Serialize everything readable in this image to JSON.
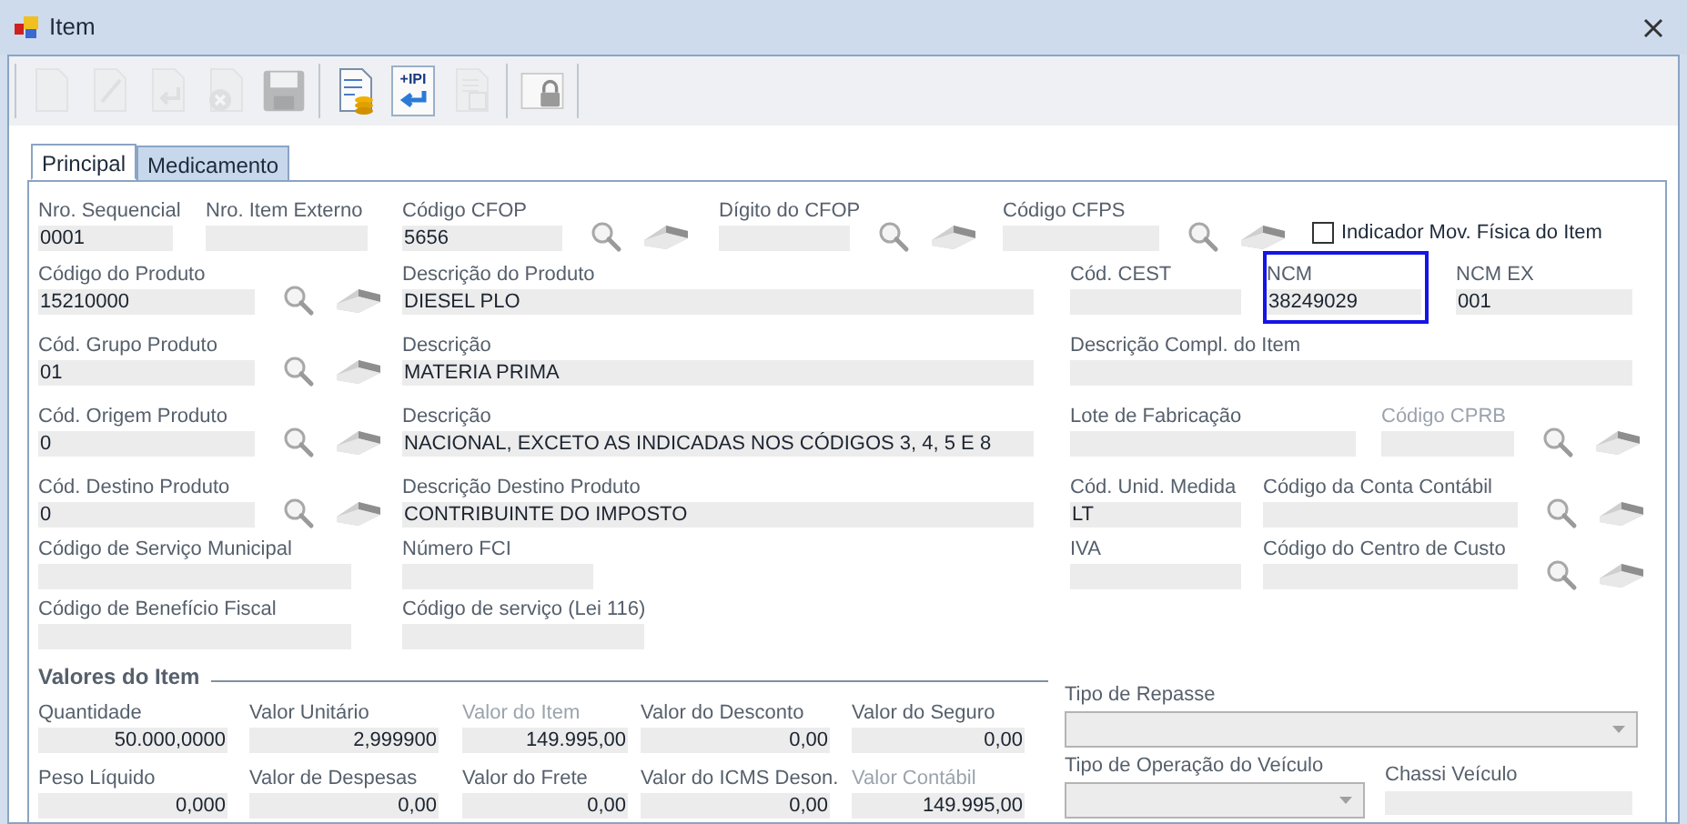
{
  "window": {
    "title": "Item"
  },
  "toolbar_groups": [
    [
      {
        "kind": "new",
        "disabled": true
      },
      {
        "kind": "edit",
        "disabled": true
      },
      {
        "kind": "undo",
        "disabled": true
      },
      {
        "kind": "delete",
        "disabled": true
      },
      {
        "kind": "save",
        "disabled": true
      }
    ],
    [
      {
        "kind": "coins",
        "disabled": false
      },
      {
        "kind": "ipi",
        "label": "+IPI",
        "disabled": false
      },
      {
        "kind": "copy",
        "disabled": true
      }
    ],
    [
      {
        "kind": "lock",
        "disabled": false
      }
    ]
  ],
  "tabs": [
    {
      "label": "Principal",
      "selected": true
    },
    {
      "label": "Medicamento",
      "selected": false
    }
  ],
  "fields": [
    {
      "label": "Nro. Sequencial",
      "value": "0001",
      "kind": "text",
      "disabled": false,
      "highlighted": false
    },
    {
      "label": "Nro. Item Externo",
      "kind": "text",
      "disabled": false,
      "highlighted": false
    },
    {
      "label": "Código CFOP",
      "value": "5656",
      "kind": "lookup",
      "disabled": false,
      "highlighted": false
    },
    {
      "label": "Dígito do CFOP",
      "kind": "lookup",
      "disabled": false,
      "highlighted": false
    },
    {
      "label": "Código CFPS",
      "kind": "lookup",
      "disabled": false,
      "highlighted": false
    },
    {
      "label": "Código do Produto",
      "value": "15210000",
      "kind": "lookup",
      "disabled": false,
      "highlighted": false
    },
    {
      "label": "Descrição do Produto",
      "value": "DIESEL PLO",
      "kind": "text",
      "disabled": false,
      "highlighted": false
    },
    {
      "label": "Cód. CEST",
      "kind": "text",
      "disabled": false,
      "highlighted": false
    },
    {
      "label": "NCM",
      "value": "38249029",
      "kind": "text",
      "disabled": false,
      "highlighted": true
    },
    {
      "label": "NCM EX",
      "value": "001",
      "kind": "text",
      "disabled": false,
      "highlighted": false
    },
    {
      "label": "Cód. Grupo Produto",
      "value": "01",
      "kind": "lookup",
      "disabled": false,
      "highlighted": false
    },
    {
      "label": "Descrição",
      "value": "MATERIA PRIMA",
      "kind": "text",
      "disabled": false,
      "highlighted": false
    },
    {
      "label": "Descrição Compl. do Item",
      "kind": "text",
      "disabled": false,
      "highlighted": false
    },
    {
      "label": "Cód. Origem Produto",
      "value": "0",
      "kind": "lookup",
      "disabled": false,
      "highlighted": false
    },
    {
      "label": "Descrição",
      "value": "NACIONAL, EXCETO AS INDICADAS NOS CÓDIGOS 3, 4, 5 E 8",
      "kind": "text",
      "disabled": false,
      "highlighted": false
    },
    {
      "label": "Lote de Fabricação",
      "kind": "text",
      "disabled": false,
      "highlighted": false
    },
    {
      "label": "Código CPRB",
      "kind": "lookup",
      "disabled": true,
      "highlighted": false
    },
    {
      "label": "Cód. Destino Produto",
      "value": "0",
      "kind": "lookup",
      "disabled": false,
      "highlighted": false
    },
    {
      "label": "Descrição Destino Produto",
      "value": "CONTRIBUINTE DO IMPOSTO",
      "kind": "text",
      "disabled": false,
      "highlighted": false
    },
    {
      "label": "Cód. Unid. Medida",
      "value": "LT",
      "kind": "text",
      "disabled": false,
      "highlighted": false
    },
    {
      "label": "Código da Conta Contábil",
      "kind": "lookup",
      "disabled": false,
      "highlighted": false
    },
    {
      "label": "Código de Serviço Municipal",
      "kind": "text",
      "disabled": false,
      "highlighted": false
    },
    {
      "label": "Número FCI",
      "kind": "text",
      "disabled": false,
      "highlighted": false
    },
    {
      "label": "IVA",
      "kind": "text",
      "disabled": false,
      "highlighted": false
    },
    {
      "label": "Código do Centro de Custo",
      "kind": "lookup",
      "disabled": false,
      "highlighted": false
    },
    {
      "label": "Código de Benefício Fiscal",
      "kind": "text",
      "disabled": false,
      "highlighted": false
    },
    {
      "label": "Código de serviço (Lei 116)",
      "kind": "text",
      "disabled": false,
      "highlighted": false
    }
  ],
  "checkbox": {
    "label": "Indicador Mov. Física do Item",
    "checked": false
  },
  "valores": {
    "title": "Valores do Item",
    "fields": [
      {
        "label": "Quantidade",
        "value": "50.000,0000",
        "disabled": false
      },
      {
        "label": "Valor Unitário",
        "value": "2,999900",
        "disabled": false
      },
      {
        "label": "Valor do Item",
        "value": "149.995,00",
        "disabled": true
      },
      {
        "label": "Valor do Desconto",
        "value": "0,00",
        "disabled": false
      },
      {
        "label": "Valor do Seguro",
        "value": "0,00",
        "disabled": false
      },
      {
        "label": "Peso Líquido",
        "value": "0,000",
        "disabled": false
      },
      {
        "label": "Valor de Despesas",
        "value": "0,00",
        "disabled": false
      },
      {
        "label": "Valor do  Frete",
        "value": "0,00",
        "disabled": false
      },
      {
        "label": "Valor do ICMS Deson.",
        "value": "0,00",
        "disabled": false
      },
      {
        "label": "Valor Contábil",
        "value": "149.995,00",
        "disabled": true
      }
    ]
  },
  "extra_fields": [
    {
      "label": "Tipo de Repasse",
      "kind": "combo"
    },
    {
      "label": "Tipo de Operação do Veículo",
      "kind": "combo"
    },
    {
      "label": "Chassi Veículo",
      "kind": "text"
    }
  ]
}
